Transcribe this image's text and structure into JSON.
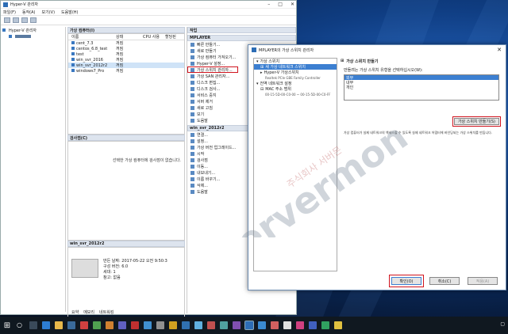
{
  "hyperv": {
    "title": "Hyper-V 관리자",
    "menu": [
      "파일(F)",
      "동작(A)",
      "보기(V)",
      "도움말(H)"
    ],
    "tree_root": "Hyper-V 관리자",
    "vm_pane_title": "가상 컴퓨터(I)",
    "vm_columns": [
      "이름",
      "상태",
      "CPU 사용",
      "할당된"
    ],
    "vms": [
      {
        "name": "cent_7.3",
        "state": "꺼짐"
      },
      {
        "name": "centos_6.8_test",
        "state": "꺼짐"
      },
      {
        "name": "test",
        "state": "꺼짐"
      },
      {
        "name": "win_svr_2016",
        "state": "꺼짐"
      },
      {
        "name": "win_svr_2012r2",
        "state": "꺼짐"
      },
      {
        "name": "windows7_Pro",
        "state": "꺼짐"
      }
    ],
    "checkpoint_title": "검사점(C)",
    "checkpoint_msg": "선택한 가상 컴퓨터에 검사점이 없습니다.",
    "detail_title": "win_svr_2012r2",
    "detail": {
      "created_label": "만든 날짜:",
      "created_value": "2017-05-22 오전 9:50:3",
      "version_label": "구성 버전:",
      "version_value": "6.0",
      "gen_label": "세대:",
      "gen_value": "1",
      "notes_label": "참고:",
      "notes_value": "없음"
    },
    "detail_tabs": [
      "요약",
      "메모리",
      "네트워킹"
    ],
    "actions_title": "작업",
    "actions_host": "MPLAYER",
    "actions": [
      "빠른 만들기...",
      "새로 만들기",
      "가상 컴퓨터 가져오기...",
      "Hyper-V 설정...",
      "가상 스위치 관리자...",
      "가상 SAN 관리자...",
      "디스크 편집...",
      "디스크 검사...",
      "서비스 중지",
      "서버 제거",
      "새로 고침",
      "보기",
      "도움말"
    ],
    "vm_actions_title": "win_svr_2012r2",
    "vm_actions": [
      "연결...",
      "설정...",
      "가상 버전 업그레이드...",
      "시작",
      "검사점",
      "이동...",
      "내보내기...",
      "이름 바꾸기...",
      "삭제...",
      "도움말"
    ]
  },
  "dialog": {
    "title": "MPLAYER의 가상 스위치 관리자",
    "left_items": [
      {
        "text": "가상 스위치",
        "kind": "group"
      },
      {
        "text": "새 가상 네트워크 스위치",
        "kind": "selected"
      },
      {
        "text": "Hyper-V 가상스위치",
        "kind": "item"
      },
      {
        "text": "Realtek PCIe GBE Family Controller",
        "kind": "small"
      },
      {
        "text": "전역 네트워크 설정",
        "kind": "group"
      },
      {
        "text": "MAC 주소 범위",
        "kind": "item"
      },
      {
        "text": "00-15-5D-00-C0-00 ~ 00-15-5D-00-C0-FF",
        "kind": "small"
      }
    ],
    "right_group": "가상 스위치 만들기",
    "right_label": "만들려는 가상 스위치 유형을 선택하십시오(W):",
    "switch_types": [
      "외부",
      "내부",
      "개인"
    ],
    "create_button": "가상 스위치 만들기(S)",
    "description": "가상 컴퓨터가 실제 네트워크의 액세스할 수 있도록 실제 네트워크 어댑터에 바인딩되는 가상 스위치를 만듭니다.",
    "ok": "확인(O)",
    "cancel": "취소(C)",
    "apply": "적용(A)"
  },
  "watermark": {
    "text": "servermon",
    "sub": "주식회사 서버몬"
  },
  "colors": {
    "highlight": "#d0141e",
    "selection": "#3c7fd1"
  }
}
